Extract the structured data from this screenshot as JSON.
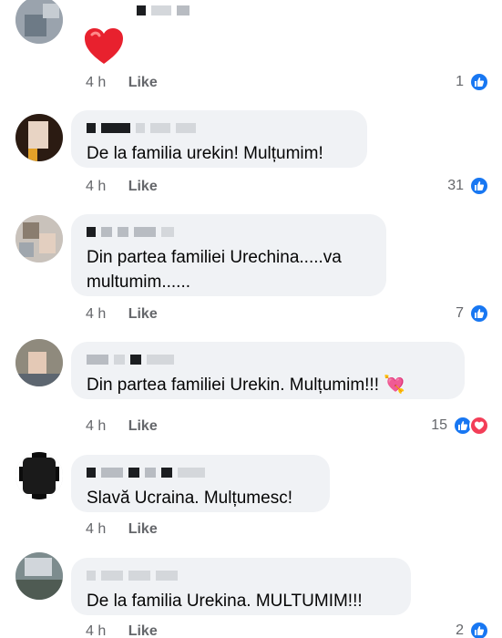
{
  "like_label": "Like",
  "comments": [
    {
      "text": "",
      "time": "4 h",
      "count": "1",
      "reactions": [
        "like"
      ],
      "emoji": "heart"
    },
    {
      "text": "De la familia urekin! Mulțumim!",
      "time": "4 h",
      "count": "31",
      "reactions": [
        "like"
      ]
    },
    {
      "text": "Din partea familiei Urechina.....va multumim......",
      "time": "4 h",
      "count": "7",
      "reactions": [
        "like"
      ]
    },
    {
      "text": "Din partea familiei Urekin. Mulțumim!!! 💘",
      "time": "4 h",
      "count": "15",
      "reactions": [
        "like",
        "love"
      ]
    },
    {
      "text": "Slavă Ucraina. Mulțumesc!",
      "time": "4 h",
      "count": "",
      "reactions": []
    },
    {
      "text": "De la familia Urekina. MULTUMIM!!!",
      "time": "4 h",
      "count": "2",
      "reactions": [
        "like"
      ]
    }
  ],
  "colors": {
    "like_blue": "#1877f2",
    "love_red": "#f33e58",
    "bubble": "#f0f2f5",
    "meta_gray": "#65676b"
  },
  "icons": [
    "thumbs-up-icon",
    "heart-icon",
    "heart-arrow-emoji"
  ]
}
